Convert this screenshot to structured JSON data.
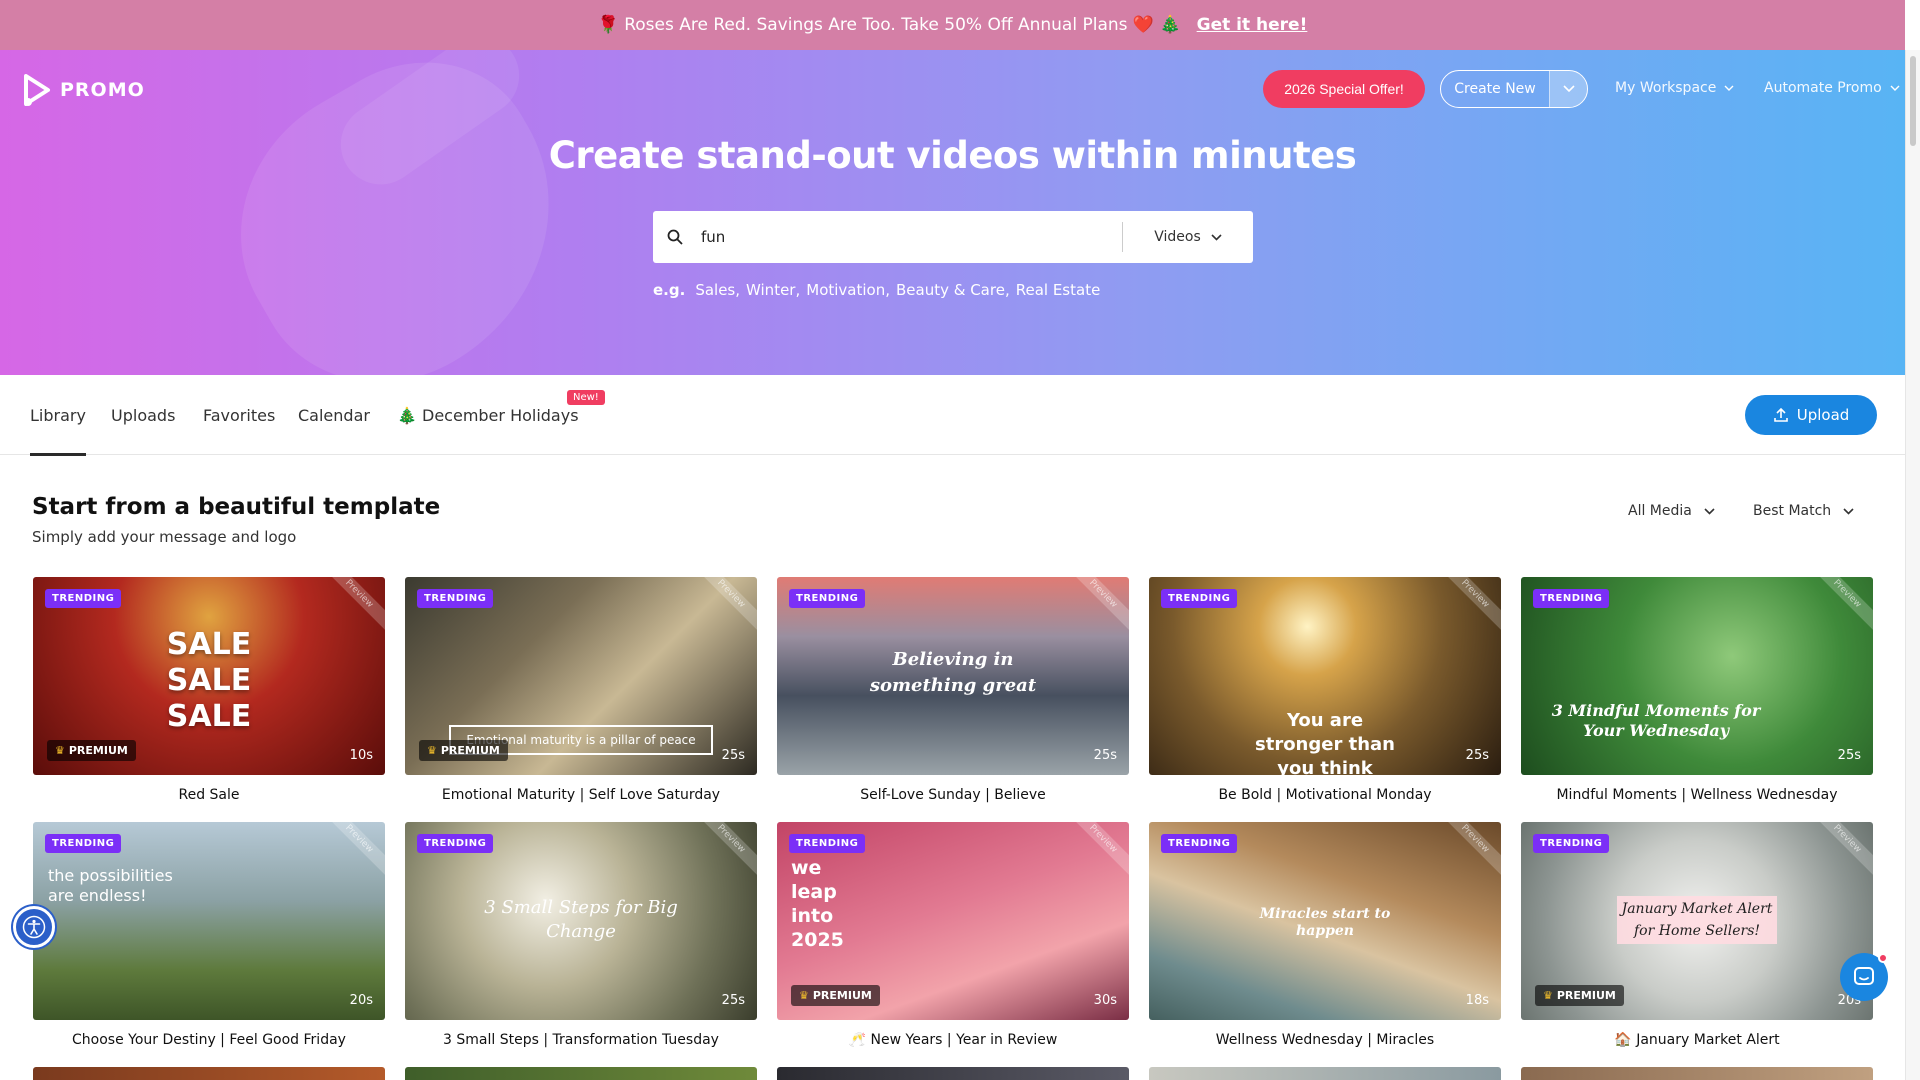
{
  "promo_banner": {
    "text": "🌹 Roses Are Red. Savings Are Too. Take 50% Off Annual Plans ❤️ 🎄",
    "cta": "Get it here!"
  },
  "header": {
    "logo": "PROMO",
    "special_offer": "2026 Special Offer!",
    "create_new": "Create New",
    "my_workspace": "My Workspace",
    "automate": "Automate Promo"
  },
  "hero": {
    "title": "Create stand-out videos within minutes",
    "search_value": "fun",
    "media_type": "Videos",
    "eg_label": "e.g.",
    "examples": [
      "Sales,",
      "Winter,",
      "Motivation,",
      "Beauty & Care,",
      "Real Estate"
    ]
  },
  "tabs": [
    "Library",
    "Uploads",
    "Favorites",
    "Calendar",
    "🎄 December Holidays"
  ],
  "new_badge": "New!",
  "upload": "Upload",
  "section": {
    "title": "Start from a beautiful template",
    "subtitle": "Simply add your message and logo",
    "filter_media": "All Media",
    "filter_sort": "Best Match"
  },
  "badges": {
    "trending": "TRENDING",
    "premium": "PREMIUM",
    "preview": "Preview"
  },
  "cards": [
    {
      "title": "Red Sale",
      "duration": "10s",
      "premium": true,
      "overlay": "SALE\nSALE\nSALE"
    },
    {
      "title": "Emotional Maturity | Self Love Saturday",
      "duration": "25s",
      "premium": true,
      "overlay": "Emotional maturity is a pillar of peace"
    },
    {
      "title": "Self-Love Sunday | Believe",
      "duration": "25s",
      "premium": false,
      "overlay": "Believing in something great"
    },
    {
      "title": "Be Bold | Motivational Monday",
      "duration": "25s",
      "premium": false,
      "overlay": "You are stronger than you think"
    },
    {
      "title": "Mindful Moments | Wellness Wednesday",
      "duration": "25s",
      "premium": false,
      "overlay": "3 Mindful Moments for Your Wednesday"
    },
    {
      "title": "Choose Your Destiny | Feel Good Friday",
      "duration": "20s",
      "premium": false,
      "overlay": "the possibilities are endless!"
    },
    {
      "title": "3 Small Steps | Transformation Tuesday",
      "duration": "25s",
      "premium": false,
      "overlay": "3 Small Steps for Big Change"
    },
    {
      "title": "🥂 New Years | Year in Review",
      "duration": "30s",
      "premium": true,
      "overlay": "we leap into 2025"
    },
    {
      "title": "Wellness Wednesday | Miracles",
      "duration": "18s",
      "premium": false,
      "overlay": "Miracles start to happen"
    },
    {
      "title": "🏠 January Market Alert",
      "duration": "20s",
      "premium": true,
      "overlay": "January Market Alert for Home Sellers!"
    }
  ]
}
